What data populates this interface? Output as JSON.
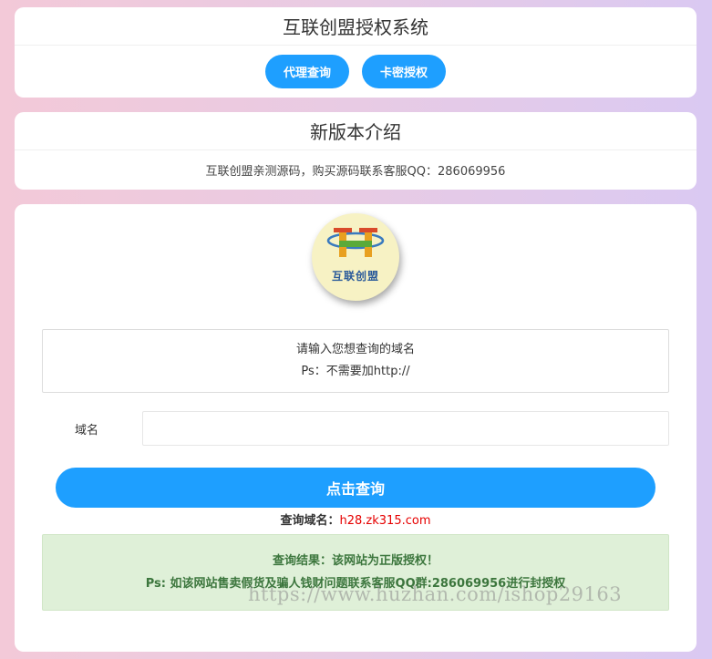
{
  "system_card": {
    "title": "互联创盟授权系统",
    "buttons": [
      {
        "label": "代理查询"
      },
      {
        "label": "卡密授权"
      }
    ]
  },
  "intro_card": {
    "title": "新版本介绍",
    "text": "互联创盟亲测源码，购买源码联系客服QQ：286069956"
  },
  "query_card": {
    "logo": {
      "text": "互联创盟"
    },
    "hint_line1": "请输入您想查询的域名",
    "hint_line2": "Ps：不需要加http://",
    "domain_label": "域名",
    "domain_value": "",
    "query_button": "点击查询",
    "queried_label": "查询域名：",
    "queried_value": "h28.zk315.com",
    "result_line1": "查询结果：该网站为正版授权！",
    "result_line2": "Ps: 如该网站售卖假货及骗人钱财问题联系客服QQ群:286069956进行封授权"
  },
  "watermark": "https://www.huzhan.com/ishop29163",
  "colors": {
    "accent": "#1e9fff",
    "success_bg": "#dff0d8",
    "success_text": "#3c763d",
    "domain_red": "#e60000"
  }
}
